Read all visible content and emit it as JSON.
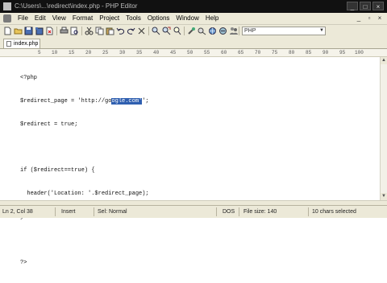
{
  "window": {
    "title": "C:\\Users\\...\\redirect\\index.php - PHP Editor"
  },
  "menu": {
    "items": [
      "File",
      "Edit",
      "View",
      "Format",
      "Project",
      "Tools",
      "Options",
      "Window",
      "Help"
    ]
  },
  "toolbar": {
    "icons": [
      "new-file-icon",
      "open-folder-icon",
      "save-icon",
      "save-all-icon",
      "close-file-icon",
      "print-icon",
      "print-preview-icon",
      "cut-icon",
      "copy-icon",
      "paste-icon",
      "undo-icon",
      "redo-icon",
      "delete-icon",
      "find-icon",
      "replace-icon",
      "find-next-icon",
      "toggle-bookmark-icon",
      "spell-check-icon",
      "browser-preview-icon",
      "ftp-icon",
      "users-icon",
      "settings-icon"
    ],
    "language_select": "PHP"
  },
  "tabs": [
    {
      "label": "index.php",
      "active": true
    }
  ],
  "ruler": {
    "ticks": [
      "5",
      "10",
      "15",
      "20",
      "25",
      "30",
      "35",
      "40",
      "45",
      "50",
      "55",
      "60",
      "65",
      "70",
      "75",
      "80",
      "85",
      "90",
      "95",
      "100"
    ]
  },
  "editor": {
    "lines": [
      {
        "before": "<?php",
        "selected": "",
        "after": ""
      },
      {
        "before": "$redirect_page = 'http://go",
        "selected": "ogle.com'",
        "after": "';"
      },
      {
        "before": "$redirect = true;",
        "selected": "",
        "after": ""
      },
      {
        "before": "",
        "selected": "",
        "after": ""
      },
      {
        "before": "if ($redirect==true) {",
        "selected": "",
        "after": ""
      },
      {
        "before": "  header('Location: '.$redirect_page);",
        "selected": "",
        "after": ""
      },
      {
        "before": "}",
        "selected": "",
        "after": ""
      },
      {
        "before": "",
        "selected": "",
        "after": ""
      },
      {
        "before": "?>",
        "selected": "",
        "after": ""
      }
    ]
  },
  "status": {
    "position": "Ln 2, Col 38",
    "mode": "Insert",
    "selection_mode": "Sel: Normal",
    "line_ending": "DOS",
    "file_size": "File size: 140",
    "selected_chars": "10 chars selected"
  }
}
